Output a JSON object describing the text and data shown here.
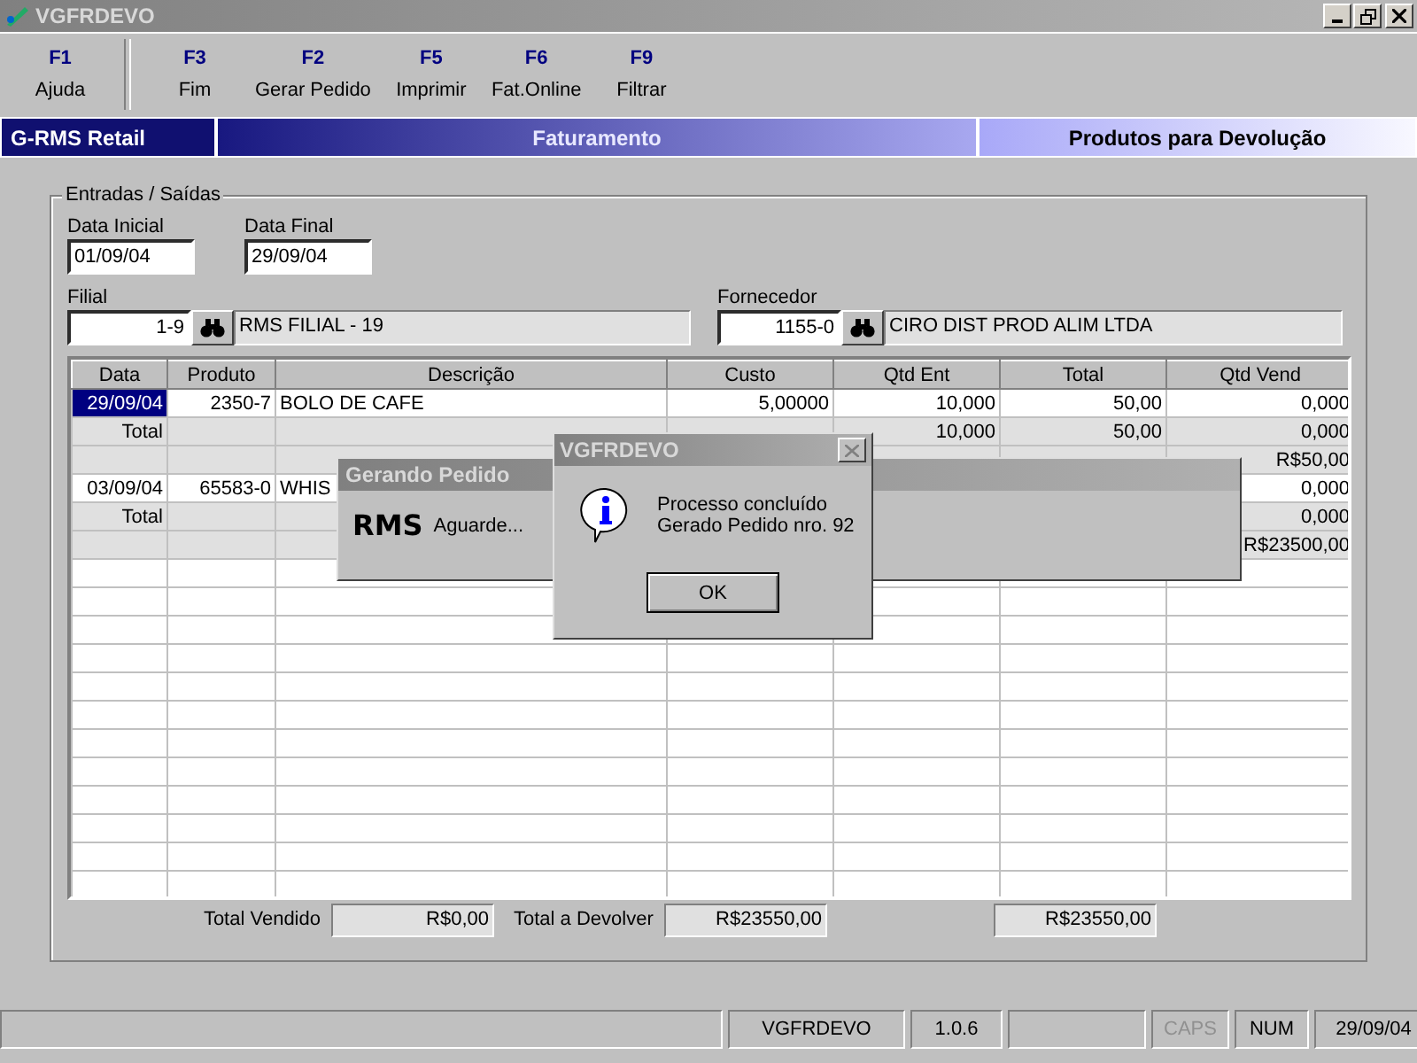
{
  "window": {
    "title": "VGFRDEVO"
  },
  "toolbar": [
    {
      "key": "F1",
      "label": "Ajuda",
      "separator_after": true
    },
    {
      "key": "F3",
      "label": "Fim",
      "separator_after": false
    },
    {
      "key": "F2",
      "label": "Gerar Pedido",
      "separator_after": false
    },
    {
      "key": "F5",
      "label": "Imprimir",
      "separator_after": false
    },
    {
      "key": "F6",
      "label": "Fat.Online",
      "separator_after": false
    },
    {
      "key": "F9",
      "label": "Filtrar",
      "separator_after": false
    }
  ],
  "banner": {
    "brand": "G-RMS Retail",
    "module": "Faturamento",
    "screen": "Produtos para Devolução"
  },
  "group": {
    "title": "Entradas / Saídas",
    "data_inicial": {
      "label": "Data Inicial",
      "value": "01/09/04"
    },
    "data_final": {
      "label": "Data Final",
      "value": "29/09/04"
    },
    "filial": {
      "label": "Filial",
      "code": "1-9",
      "name": "RMS FILIAL - 19"
    },
    "fornecedor": {
      "label": "Fornecedor",
      "code": "1155-0",
      "name": "CIRO DIST PROD ALIM LTDA"
    }
  },
  "table": {
    "columns": [
      "Data",
      "Produto",
      "Descrição",
      "Custo",
      "Qtd Ent",
      "Total",
      "Qtd Vend"
    ],
    "rows": [
      {
        "kind": "item",
        "selected": true,
        "cells": [
          "29/09/04",
          "2350-7",
          "BOLO DE CAFE",
          "5,00000",
          "10,000",
          "50,00",
          "0,000"
        ]
      },
      {
        "kind": "total",
        "selected": false,
        "cells": [
          "Total",
          "",
          "",
          "",
          "10,000",
          "50,00",
          "0,000"
        ]
      },
      {
        "kind": "total",
        "selected": false,
        "cells": [
          "",
          "",
          "",
          "",
          "",
          "",
          "R$50,00"
        ]
      },
      {
        "kind": "item",
        "selected": false,
        "cells": [
          "03/09/04",
          "65583-0",
          "WHIS",
          "",
          "",
          "",
          "0,000"
        ]
      },
      {
        "kind": "total",
        "selected": false,
        "cells": [
          "Total",
          "",
          "",
          "",
          "",
          "",
          "0,000"
        ]
      },
      {
        "kind": "total",
        "selected": false,
        "cells": [
          "",
          "",
          "",
          "",
          "",
          "",
          "R$23500,00"
        ]
      }
    ]
  },
  "totals": {
    "vendido_label": "Total Vendido",
    "vendido": "R$0,00",
    "devolver_label": "Total a Devolver",
    "devolver": "R$23550,00",
    "column_3": "R$23550,00"
  },
  "progress_dialog": {
    "title": "Gerando Pedido",
    "logo": "RMS",
    "message": "Aguarde..."
  },
  "message_box": {
    "title": "VGFRDEVO",
    "lines": [
      "Processo concluído",
      "Gerado Pedido nro. 92"
    ],
    "button": "OK"
  },
  "status_bar": [
    {
      "kind": "blank"
    },
    {
      "kind": "text",
      "text": "VGFRDEVO",
      "disabled": false
    },
    {
      "kind": "text",
      "text": "1.0.6",
      "disabled": false
    },
    {
      "kind": "blank"
    },
    {
      "kind": "text",
      "text": "CAPS",
      "disabled": true
    },
    {
      "kind": "text",
      "text": "NUM",
      "disabled": false
    },
    {
      "kind": "text",
      "text": "29/09/04",
      "disabled": false
    }
  ]
}
